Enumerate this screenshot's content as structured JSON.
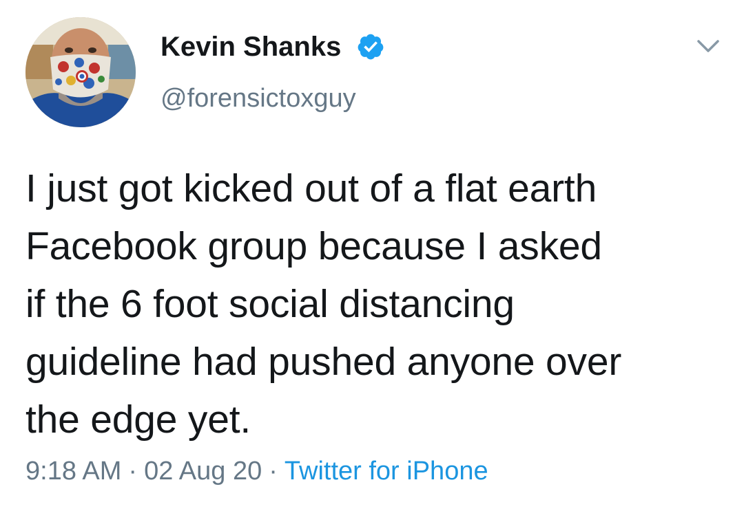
{
  "author": {
    "display_name": "Kevin Shanks",
    "handle": "@forensictoxguy",
    "verified_icon": "verified-badge-icon",
    "avatar_icon": "profile-photo"
  },
  "tweet": {
    "lines": [
      "I just got kicked out of a flat earth",
      "Facebook group because I asked",
      "if the 6 foot social distancing",
      "guideline had pushed anyone over",
      "the edge yet."
    ]
  },
  "meta": {
    "time": "9:18 AM",
    "separator": "·",
    "date": "02 Aug 20",
    "source": "Twitter for iPhone"
  },
  "menu": {
    "icon": "chevron-down-icon"
  },
  "colors": {
    "text": "#14171a",
    "secondary": "#657786",
    "link": "#1b95e0",
    "verified": "#1da1f2"
  }
}
